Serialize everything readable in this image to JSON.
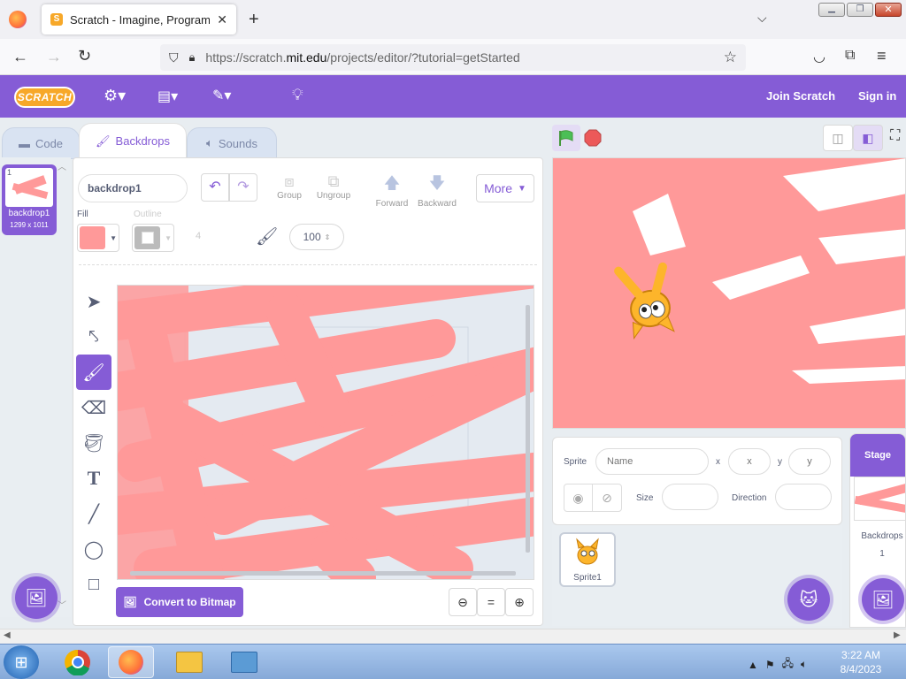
{
  "browser": {
    "tab_title": "Scratch - Imagine, Program, Sh",
    "url_prefix": "https://scratch.",
    "url_domain": "mit.edu",
    "url_rest": "/projects/editor/?tutorial=getStarted",
    "new_tab": "+"
  },
  "menubar": {
    "logo": "SCRATCH",
    "join": "Join Scratch",
    "signin": "Sign in"
  },
  "editor": {
    "tabs": [
      "Code",
      "Backdrops",
      "Sounds"
    ],
    "costume": {
      "number": "1",
      "name": "backdrop1",
      "size": "1299 x 1011"
    },
    "name_value": "backdrop1",
    "tool_labels": {
      "group": "Group",
      "ungroup": "Ungroup",
      "forward": "Forward",
      "backward": "Backward",
      "more": "More"
    },
    "fill_label": "Fill",
    "outline_label": "Outline",
    "outline_width": "4",
    "brush_size": "100",
    "convert": "Convert to Bitmap",
    "fill_color": "#ff9999"
  },
  "sprite": {
    "label": "Sprite",
    "name_placeholder": "Name",
    "x_label": "x",
    "x_placeholder": "x",
    "y_label": "y",
    "y_placeholder": "y",
    "size_label": "Size",
    "direction_label": "Direction",
    "sprite1": "Sprite1"
  },
  "stage": {
    "title": "Stage",
    "backdrops_label": "Backdrops",
    "backdrops_count": "1"
  },
  "taskbar": {
    "time": "3:22 AM",
    "date": "8/4/2023"
  },
  "colors": {
    "accent": "#855cd6",
    "stage_pink": "#ff9999",
    "green_flag": "#4cbf56",
    "stop": "#ec5959"
  }
}
